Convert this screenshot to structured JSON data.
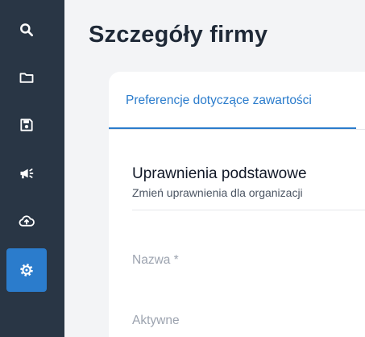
{
  "sidebar": {
    "items": [
      {
        "icon": "search-icon",
        "active": false
      },
      {
        "icon": "folder-icon",
        "active": false
      },
      {
        "icon": "save-icon",
        "active": false
      },
      {
        "icon": "megaphone-icon",
        "active": false
      },
      {
        "icon": "cloud-upload-icon",
        "active": false
      },
      {
        "icon": "gear-icon",
        "active": true
      }
    ],
    "colors": {
      "background": "#293645",
      "icon": "#ffffff",
      "active": "#2b7ccc"
    }
  },
  "main": {
    "title": "Szczegóły firmy",
    "tabs": [
      {
        "label": "Preferencje dotyczące zawartości",
        "active": true
      }
    ],
    "section": {
      "title": "Uprawnienia podstawowe",
      "subtitle": "Zmień uprawnienia dla organizacji"
    },
    "fields": [
      {
        "label": "Nazwa *"
      },
      {
        "label": "Aktywne"
      }
    ]
  }
}
